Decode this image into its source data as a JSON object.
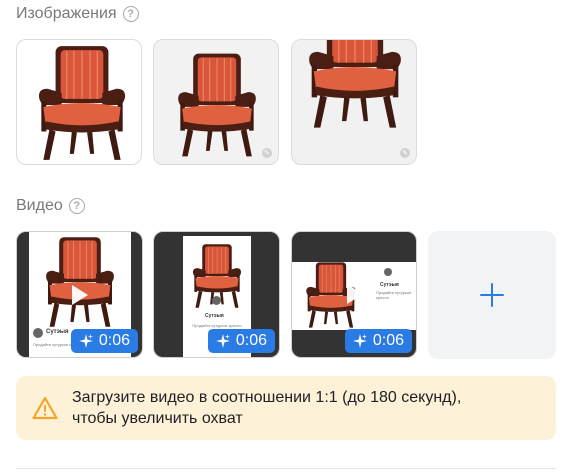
{
  "images_section": {
    "title": "Изображения",
    "help_glyph": "?"
  },
  "video_section": {
    "title": "Видео",
    "help_glyph": "?"
  },
  "videos": [
    {
      "duration": "0:06",
      "channel_name": "Cyтэыя",
      "channel_sub": "Продайте кутуркое кресло"
    },
    {
      "duration": "0:06",
      "channel_name": "Сутэыя",
      "channel_sub": "Продайте кутуркое кресло двадцати"
    },
    {
      "duration": "0:06",
      "channel_name": "Сутэыя",
      "channel_sub": "Продайте кутуркое кресло"
    }
  ],
  "warning": {
    "line1": "Загрузите видео в соотношении 1:1 (до 180 секунд),",
    "line2": "чтобы увеличить охват"
  },
  "icons": {
    "help": "help-circle-icon",
    "sparkle": "sparkle-icon",
    "play": "play-icon",
    "plus": "plus-icon",
    "warning": "warning-triangle-icon",
    "edit": "pencil-icon"
  },
  "colors": {
    "accent": "#2a7be4",
    "warning_bg": "#fdf1d8",
    "warning_icon": "#f5a623",
    "chair_fabric": "#d9553b",
    "chair_wood": "#4a1e12"
  }
}
